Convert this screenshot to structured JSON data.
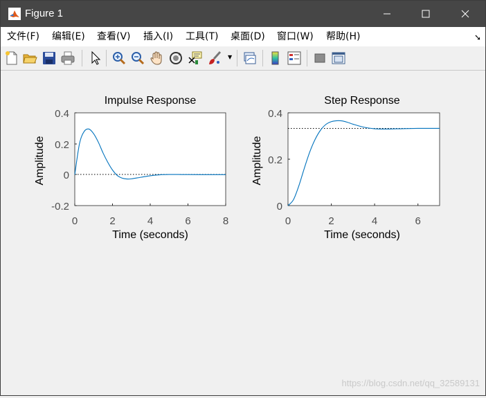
{
  "window": {
    "title": "Figure 1"
  },
  "menu": {
    "items": [
      "文件(F)",
      "编辑(E)",
      "查看(V)",
      "插入(I)",
      "工具(T)",
      "桌面(D)",
      "窗口(W)",
      "帮助(H)"
    ]
  },
  "toolbar": {
    "icons": [
      "new-figure-icon",
      "open-file-icon",
      "save-icon",
      "print-icon",
      "pointer-icon",
      "zoom-in-icon",
      "zoom-out-icon",
      "pan-hand-icon",
      "rotate-3d-icon",
      "data-cursor-icon",
      "brush-icon",
      "link-plot-icon",
      "colorbar-icon",
      "legend-icon",
      "hide-plot-tools-icon",
      "show-plot-tools-icon"
    ]
  },
  "watermark": "https://blog.csdn.net/qq_32589131",
  "chart_data": [
    {
      "type": "line",
      "title": "Impulse Response",
      "xlabel": "Time (seconds)",
      "ylabel": "Amplitude",
      "xlim": [
        0,
        8
      ],
      "ylim": [
        -0.2,
        0.4
      ],
      "xticks": [
        "0",
        "2",
        "4",
        "6",
        "8"
      ],
      "yticks": [
        "-0.2",
        "0",
        "0.2",
        "0.4"
      ],
      "reference_line": 0,
      "series": [
        {
          "x": [
            0,
            0.25,
            0.5,
            0.75,
            1.0,
            1.25,
            1.5,
            1.75,
            2.0,
            2.25,
            2.5,
            2.75,
            3.0,
            3.5,
            4.0,
            4.5,
            5.0,
            5.5,
            6.0,
            7.0,
            8.0
          ],
          "y": [
            0,
            0.2,
            0.28,
            0.295,
            0.265,
            0.21,
            0.14,
            0.08,
            0.03,
            -0.005,
            -0.022,
            -0.028,
            -0.027,
            -0.017,
            -0.007,
            -0.001,
            0.001,
            0.001,
            0.0005,
            0,
            0
          ],
          "color": "#0072bd"
        }
      ]
    },
    {
      "type": "line",
      "title": "Step Response",
      "xlabel": "Time (seconds)",
      "ylabel": "Amplitude",
      "xlim": [
        0,
        7
      ],
      "ylim": [
        0,
        0.4
      ],
      "xticks": [
        "0",
        "2",
        "4",
        "6"
      ],
      "yticks": [
        "0",
        "0.2",
        "0.4"
      ],
      "reference_line": 0.333,
      "series": [
        {
          "x": [
            0,
            0.25,
            0.5,
            0.75,
            1.0,
            1.25,
            1.5,
            1.75,
            2.0,
            2.25,
            2.5,
            2.75,
            3.0,
            3.5,
            4.0,
            4.5,
            5.0,
            6.0,
            7.0
          ],
          "y": [
            0,
            0.025,
            0.085,
            0.16,
            0.23,
            0.285,
            0.325,
            0.35,
            0.362,
            0.366,
            0.365,
            0.359,
            0.351,
            0.338,
            0.331,
            0.33,
            0.331,
            0.333,
            0.333
          ],
          "color": "#0072bd"
        }
      ]
    }
  ]
}
